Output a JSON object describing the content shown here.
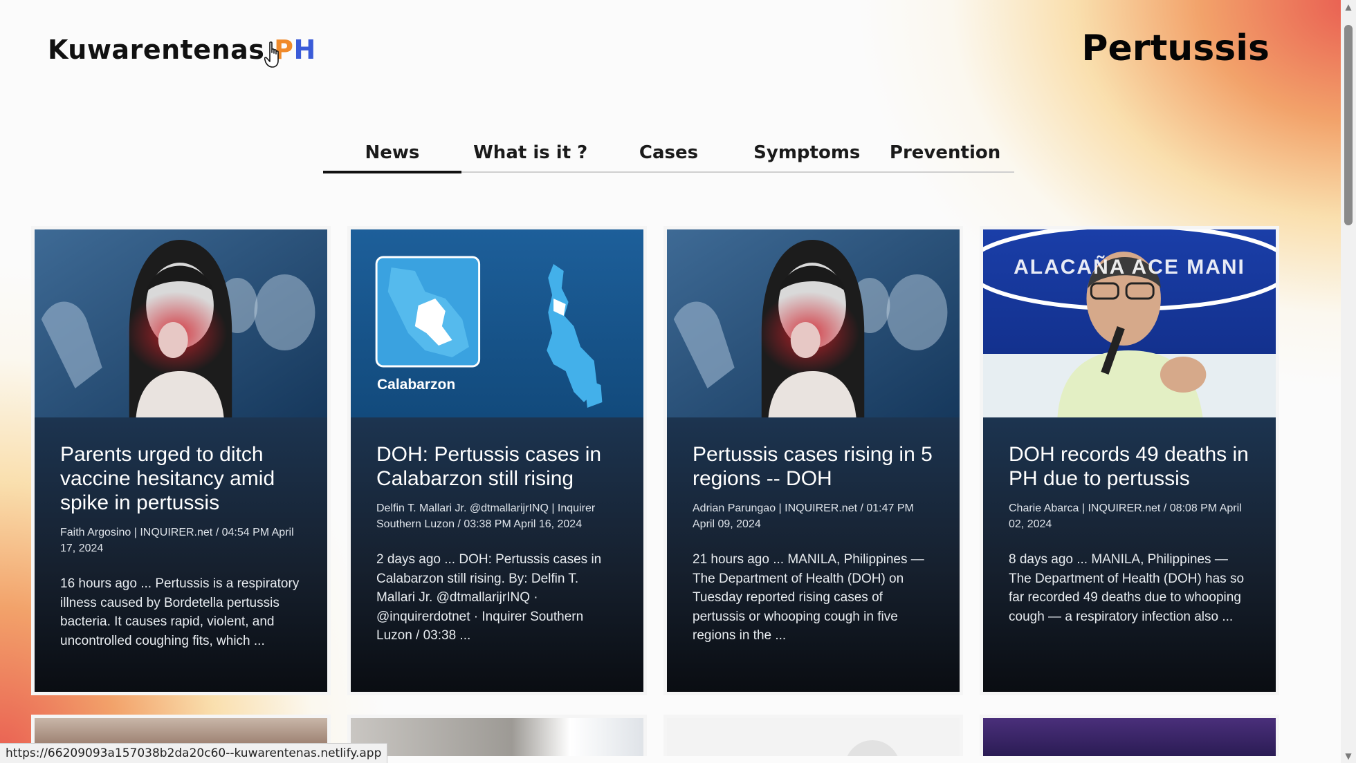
{
  "logo": {
    "main": "Kuwarentenas ",
    "ph_p": "P",
    "ph_h": "H"
  },
  "page_title": "Pertussis",
  "tabs": [
    {
      "label": "News",
      "active": true
    },
    {
      "label": "What is it ?",
      "active": false
    },
    {
      "label": "Cases",
      "active": false
    },
    {
      "label": "Symptoms",
      "active": false
    },
    {
      "label": "Prevention",
      "active": false
    }
  ],
  "cards": [
    {
      "title": "Parents urged to ditch vaccine hesitancy amid spike in pertussis",
      "meta": "Faith Argosino | INQUIRER.net / 04:54 PM April 17, 2024",
      "snippet": "16 hours ago ... Pertussis is a respiratory illness caused by Bordetella pertussis bacteria. It causes rapid, violent, and uncontrolled coughing fits, which ..."
    },
    {
      "title": "DOH: Pertussis cases in Calabarzon still rising",
      "meta": "Delfin T. Mallari Jr. @dtmallarijrINQ | Inquirer Southern Luzon / 03:38 PM April 16, 2024",
      "snippet": "2 days ago ... DOH: Pertussis cases in Calabarzon still rising. By: Delfin T. Mallari Jr. @dtmallarijrINQ · @inquirerdotnet · Inquirer Southern Luzon / 03:38 ...",
      "image_label": "Calabarzon"
    },
    {
      "title": "Pertussis cases rising in 5 regions -- DOH",
      "meta": "Adrian Parungao | INQUIRER.net / 01:47 PM April 09, 2024",
      "snippet": "21 hours ago ... MANILA, Philippines — The Department of Health (DOH) on Tuesday reported rising cases of pertussis or whooping cough in five regions in the ..."
    },
    {
      "title": "DOH records 49 deaths in PH due to pertussis",
      "meta": "Charie Abarca | INQUIRER.net / 08:08 PM April 02, 2024",
      "snippet": "8 days ago ... MANILA, Philippines — The Department of Health (DOH) has so far recorded 49 deaths due to whooping cough — a respiratory infection also ...",
      "image_label": "ALACAÑA ACE MANI"
    }
  ],
  "status_url": "https://66209093a157038b2da20c60--kuwarentenas.netlify.app"
}
